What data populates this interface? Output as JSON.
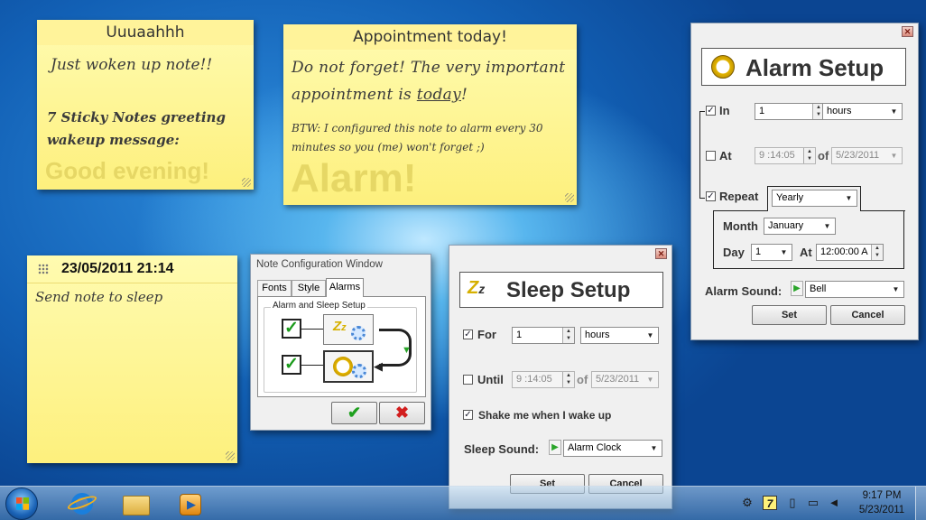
{
  "notes": {
    "wake": {
      "title": "Uuuaahhh",
      "line1": "Just woken up note!!",
      "line2": "7 Sticky Notes greeting",
      "line3": "wakeup message:",
      "big": "Good evening!"
    },
    "appointment": {
      "title": "Appointment today!",
      "line1": "Do not forget! The very important",
      "line2a": "appointment is ",
      "line2b": "today",
      "line2c": "!",
      "line3": "BTW: I configured this note to alarm every 30",
      "line4": "minutes so you (me) won't forget ;)",
      "big": "Alarm!"
    },
    "sleep": {
      "title": "23/05/2011 21:14",
      "body": "Send note to sleep"
    }
  },
  "config": {
    "title": "Note Configuration Window",
    "tabs": [
      "Fonts",
      "Style",
      "Alarms"
    ],
    "group": "Alarm and Sleep Setup",
    "ok_symbol": "✔",
    "cancel_symbol": "✖"
  },
  "sleep_setup": {
    "title": "Sleep Setup",
    "for_label": "For",
    "for_value": "1",
    "for_unit": "hours",
    "until_label": "Until",
    "until_time": "9 :14:05",
    "of": "of",
    "until_date": "5/23/2011",
    "shake": "Shake me when I wake up",
    "sound_label": "Sleep Sound:",
    "sound_value": "Alarm Clock",
    "set": "Set",
    "cancel": "Cancel"
  },
  "alarm_setup": {
    "title": "Alarm Setup",
    "in_label": "In",
    "in_value": "1",
    "in_unit": "hours",
    "at_label": "At",
    "at_time": "9 :14:05",
    "of": "of",
    "at_date": "5/23/2011",
    "repeat_label": "Repeat",
    "repeat_value": "Yearly",
    "month_label": "Month",
    "month_value": "January",
    "day_label": "Day",
    "day_value": "1",
    "at2_label": "At",
    "time_value": "12:00:00 A",
    "sound_label": "Alarm Sound:",
    "sound_value": "Bell",
    "set": "Set",
    "cancel": "Cancel"
  },
  "taskbar": {
    "time": "9:17 PM",
    "date": "5/23/2011",
    "tray_badge": "7"
  },
  "checks": {
    "mark": "✓",
    "dropdown": "▼"
  }
}
